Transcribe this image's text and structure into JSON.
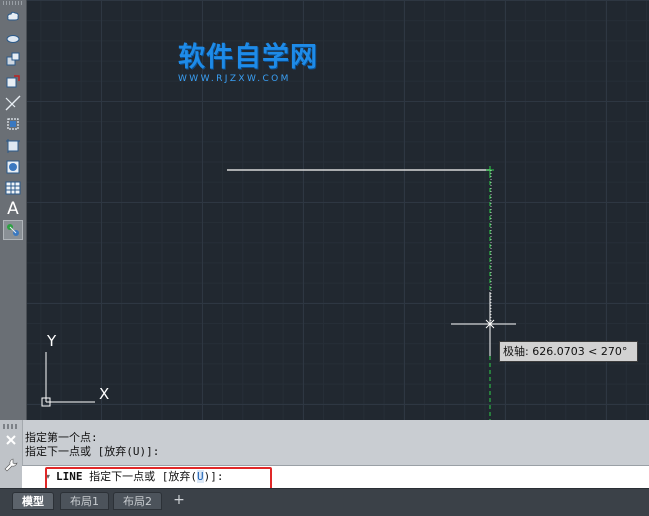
{
  "toolbar": {
    "tools": [
      {
        "name": "revision-cloud-icon"
      },
      {
        "name": "spline-icon"
      },
      {
        "name": "ellipse-icon"
      },
      {
        "name": "ellipse-arc-icon"
      },
      {
        "name": "construction-line-icon"
      },
      {
        "name": "insert-block-icon"
      },
      {
        "name": "make-block-icon"
      },
      {
        "name": "region-icon"
      },
      {
        "name": "table-icon"
      },
      {
        "name": "multiline-text-icon",
        "glyph": "A"
      },
      {
        "name": "add-selected-icon"
      }
    ]
  },
  "logo": {
    "title": "软件自学网",
    "subtitle": "WWW.RJZXW.COM"
  },
  "canvas": {
    "ucs_x_label": "X",
    "ucs_y_label": "Y",
    "tooltip": "极轴: 626.0703 < 270°",
    "colors": {
      "background": "#212830",
      "line": "#d8d8d8",
      "tracking": "#2fd14a",
      "crosshair": "#ffffff"
    }
  },
  "command": {
    "history": [
      "指定第一个点:",
      "指定下一点或 [放弃(U)]:"
    ],
    "input": {
      "command_name": "LINE",
      "prompt_text": " 指定下一点或 [放弃(",
      "option_key": "U",
      "prompt_end": ")]:"
    }
  },
  "tabs": [
    {
      "label": "模型",
      "active": true
    },
    {
      "label": "布局1",
      "active": false
    },
    {
      "label": "布局2",
      "active": false
    }
  ],
  "tab_add": "+",
  "highlight_color": "#e02828"
}
